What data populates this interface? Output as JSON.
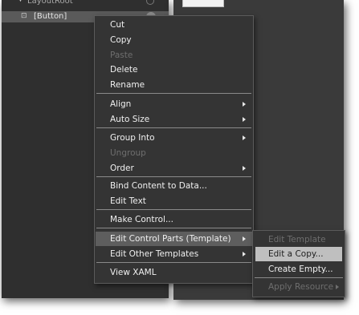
{
  "tree": {
    "parent_label": "LayoutRoot",
    "selected_label": "[Button]"
  },
  "context_menu": {
    "items": [
      {
        "label": "Cut",
        "enabled": true
      },
      {
        "label": "Copy",
        "enabled": true
      },
      {
        "label": "Paste",
        "enabled": false
      },
      {
        "label": "Delete",
        "enabled": true
      },
      {
        "label": "Rename",
        "enabled": true
      },
      {
        "label": "Align",
        "enabled": true,
        "submenu": true
      },
      {
        "label": "Auto Size",
        "enabled": true,
        "submenu": true
      },
      {
        "label": "Group Into",
        "enabled": true,
        "submenu": true
      },
      {
        "label": "Ungroup",
        "enabled": false
      },
      {
        "label": "Order",
        "enabled": true,
        "submenu": true
      },
      {
        "label": "Bind Content to Data...",
        "enabled": true
      },
      {
        "label": "Edit Text",
        "enabled": true
      },
      {
        "label": "Make Control...",
        "enabled": true
      },
      {
        "label": "Edit Control Parts (Template)",
        "enabled": true,
        "submenu": true,
        "highlighted": true
      },
      {
        "label": "Edit Other Templates",
        "enabled": true,
        "submenu": true
      },
      {
        "label": "View XAML",
        "enabled": true
      }
    ]
  },
  "submenu": {
    "items": [
      {
        "label": "Edit Template",
        "enabled": false
      },
      {
        "label": "Edit a Copy...",
        "enabled": true,
        "highlighted": true
      },
      {
        "label": "Create Empty...",
        "enabled": true
      },
      {
        "label": "Apply Resource",
        "enabled": false,
        "submenu": true
      }
    ]
  },
  "colors": {
    "menu_bg": "#343434",
    "panel_bg": "#2f2f2f",
    "highlight": "#5e5e5e",
    "submenu_highlight": "#bfbfbf",
    "disabled_text": "#6e6e6e"
  }
}
